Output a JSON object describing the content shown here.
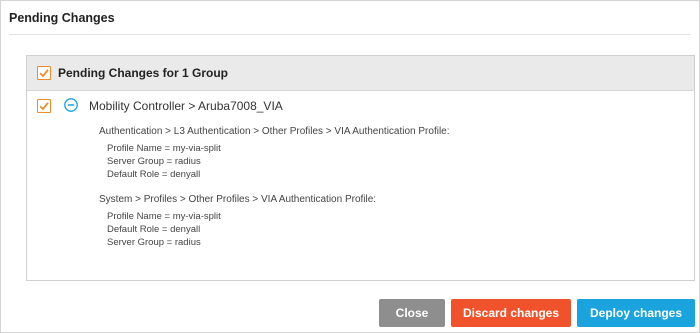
{
  "dialog": {
    "title": "Pending Changes"
  },
  "panel": {
    "header_label": "Pending Changes for 1 Group",
    "header_checked": true,
    "group": {
      "title": "Mobility Controller > Aruba7008_VIA",
      "checked": true,
      "sections": [
        {
          "heading": "Authentication > L3 Authentication > Other Profiles > VIA Authentication Profile:",
          "lines": [
            "Profile Name = my-via-split",
            "Server Group = radius",
            "Default Role = denyall"
          ]
        },
        {
          "heading": "System > Profiles > Other Profiles > VIA Authentication Profile:",
          "lines": [
            "Profile Name = my-via-split",
            "Default Role = denyall",
            "Server Group = radius"
          ]
        }
      ]
    }
  },
  "footer": {
    "close_label": "Close",
    "discard_label": "Discard changes",
    "deploy_label": "Deploy changes"
  },
  "colors": {
    "checkbox": "#f08c2b",
    "close": "#8e8e8e",
    "discard": "#f0532b",
    "deploy": "#1aa3dc",
    "collapse_icon": "#1aa3dc"
  }
}
